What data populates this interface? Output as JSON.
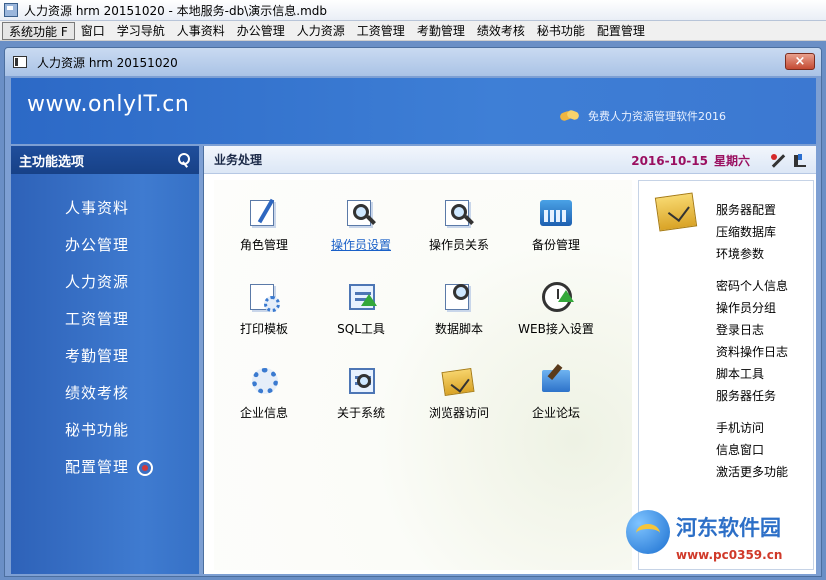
{
  "window": {
    "outer_title": "人力资源 hrm 20151020 - 本地服务-db\\演示信息.mdb",
    "inner_title": "人力资源 hrm 20151020",
    "close_label": "×"
  },
  "menu": [
    "系统功能 F",
    "窗口",
    "学习导航",
    "人事资料",
    "办公管理",
    "人力资源",
    "工资管理",
    "考勤管理",
    "绩效考核",
    "秘书功能",
    "配置管理"
  ],
  "banner": {
    "url": "www.onlyIT.cn",
    "slogan": "免费人力资源管理软件2016"
  },
  "sidebar": {
    "title": "主功能选项",
    "items": [
      "人事资料",
      "办公管理",
      "人力资源",
      "工资管理",
      "考勤管理",
      "绩效考核",
      "秘书功能",
      "配置管理"
    ]
  },
  "panel": {
    "title": "业务处理",
    "date": "2016-10-15",
    "weekday": "星期六"
  },
  "grid": [
    {
      "label": "角色管理",
      "icon": "edit-doc-icon",
      "link": false
    },
    {
      "label": "操作员设置",
      "icon": "magnifier-chart-icon",
      "link": true
    },
    {
      "label": "操作员关系",
      "icon": "magnifier-icon",
      "link": false
    },
    {
      "label": "备份管理",
      "icon": "calculator-icon",
      "link": false
    },
    {
      "label": "打印模板",
      "icon": "print-template-icon",
      "link": false
    },
    {
      "label": "SQL工具",
      "icon": "sql-tool-icon",
      "link": false
    },
    {
      "label": "数据脚本",
      "icon": "script-icon",
      "link": false
    },
    {
      "label": "WEB接入设置",
      "icon": "clock-arrow-icon",
      "link": false
    },
    {
      "label": "企业信息",
      "icon": "gear-icon",
      "link": false
    },
    {
      "label": "关于系统",
      "icon": "about-window-icon",
      "link": false
    },
    {
      "label": "浏览器访问",
      "icon": "folder-check-icon",
      "link": false
    },
    {
      "label": "企业论坛",
      "icon": "hammer-icon",
      "link": false
    }
  ],
  "right": {
    "group1": [
      "服务器配置",
      "压缩数据库",
      "环境参数"
    ],
    "group2": [
      "密码个人信息",
      "操作员分组",
      "登录日志",
      "资料操作日志",
      "脚本工具",
      "服务器任务"
    ],
    "group3": [
      "手机访问",
      "信息窗口",
      "激活更多功能"
    ]
  },
  "watermark": {
    "name": "河东软件园",
    "url": "www.pc0359.cn"
  }
}
